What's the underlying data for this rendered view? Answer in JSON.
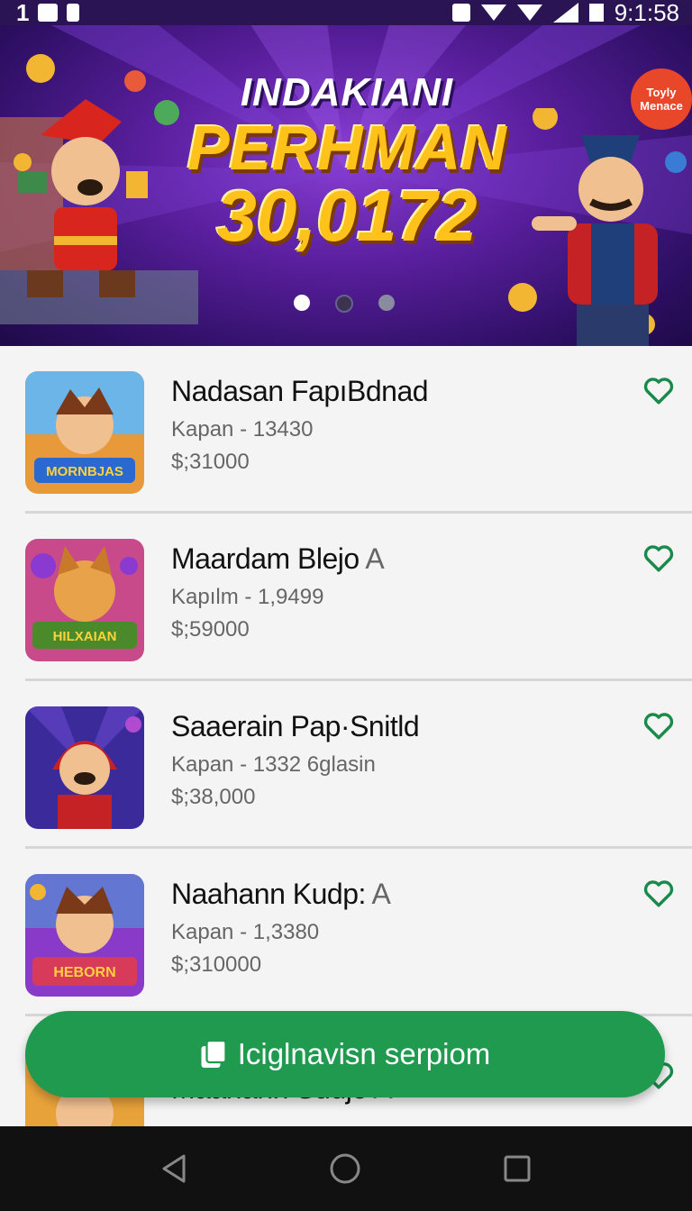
{
  "status_bar": {
    "left_text": "1",
    "time": "9:1:58"
  },
  "banner": {
    "subtitle": "INDAKIANI",
    "title": "PERHMAN",
    "number": "30,0172",
    "bubble_line1": "Toyly",
    "bubble_line2": "Menace",
    "page_count": 3,
    "active_page": 1
  },
  "items": [
    {
      "name": "Nadasan FapıBdnad",
      "name_tail": "",
      "meta": "Kapan - 13430",
      "price": "$;31000",
      "thumb_text": "MORNBJAS"
    },
    {
      "name": "Maardam Blejo",
      "name_tail": "A",
      "meta": "Kapılm - 1,9499",
      "price": "$;59000",
      "thumb_text": "HILXAIAN"
    },
    {
      "name": "Saaerain Pap·Snitld",
      "name_tail": "",
      "meta": "Kapan - 1332 6glasin",
      "price": "$;38,000",
      "thumb_text": ""
    },
    {
      "name": "Naahann Kudp:",
      "name_tail": "A",
      "meta": "Kapan - 1,3380",
      "price": "$;310000",
      "thumb_text": "HEBORN"
    },
    {
      "name": "Maahann Sudjo",
      "name_tail": "A",
      "meta": "",
      "price": "",
      "thumb_text": ""
    }
  ],
  "cta": {
    "label": "Iciglnavisn serpiom",
    "icon": "wallet-icon"
  },
  "colors": {
    "accent_green": "#1f9a4f",
    "heart_green": "#1a8a4a",
    "banner_purple": "#5a1f9e"
  },
  "navigation": {
    "back_icon": "back-triangle-icon",
    "home_icon": "home-circle-icon",
    "recents_icon": "recents-square-icon"
  }
}
